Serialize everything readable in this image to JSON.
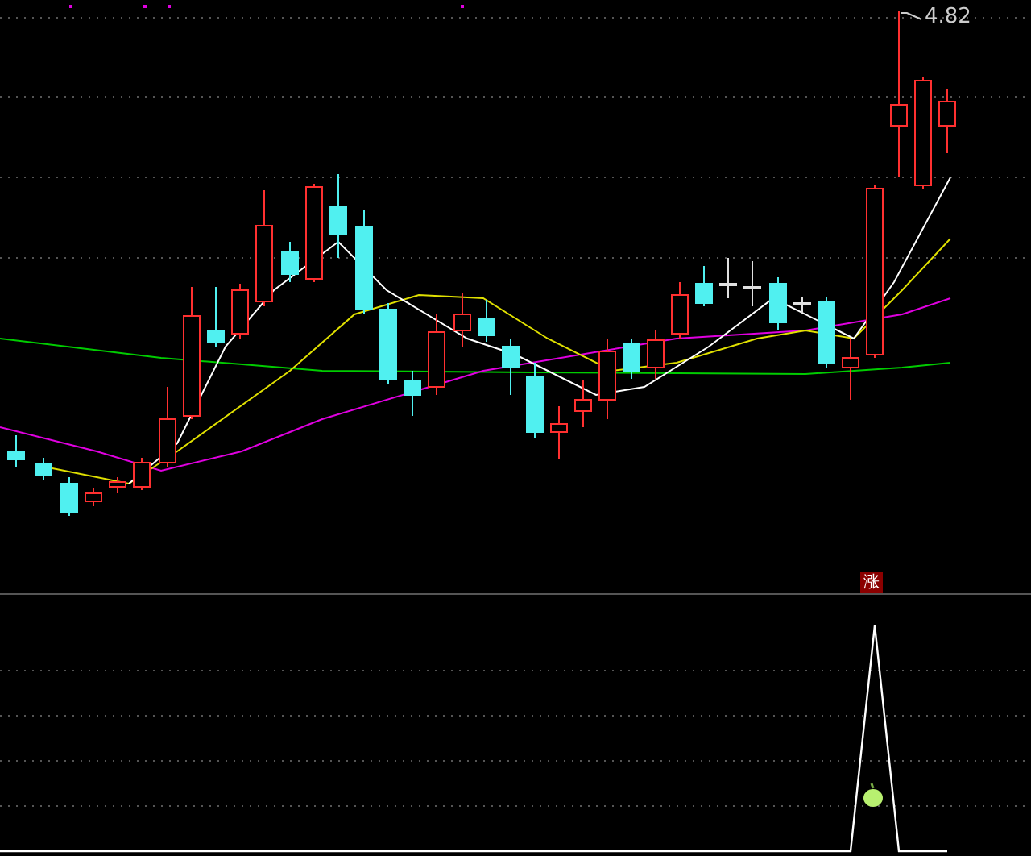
{
  "price_chart": {
    "high_label": "4.82"
  },
  "signal_panel": {
    "signal_badge": "涨"
  }
}
